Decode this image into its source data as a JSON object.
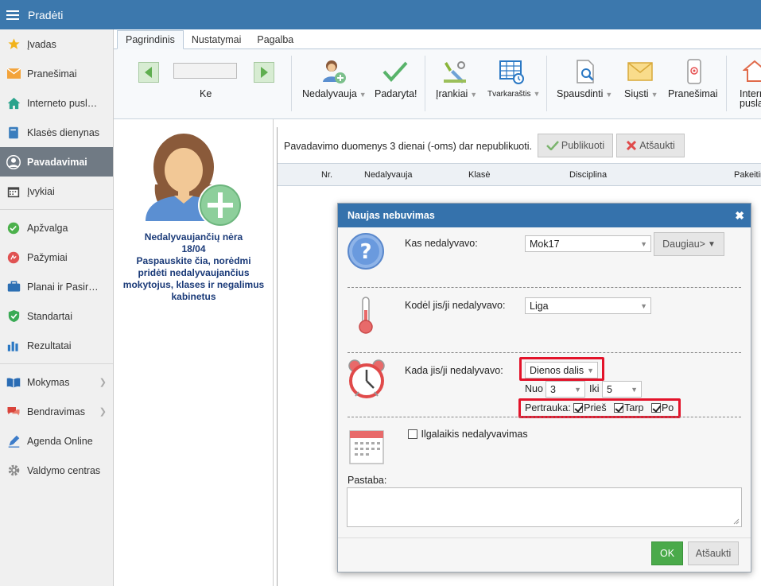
{
  "topbar": {
    "title": "Pradėti"
  },
  "sidebar": {
    "items": [
      {
        "label": "Įvadas",
        "icon": "star-icon"
      },
      {
        "label": "Pranešimai",
        "icon": "envelope-icon"
      },
      {
        "label": "Interneto pusl…",
        "icon": "home-icon"
      },
      {
        "label": "Klasės dienynas",
        "icon": "book-icon"
      },
      {
        "label": "Pavadavimai",
        "icon": "user-icon"
      },
      {
        "label": "Įvykiai",
        "icon": "calendar-icon"
      },
      {
        "label": "Apžvalga",
        "icon": "check-circle-icon"
      },
      {
        "label": "Pažymiai",
        "icon": "grade-icon"
      },
      {
        "label": "Planai ir Pasir…",
        "icon": "briefcase-icon"
      },
      {
        "label": "Standartai",
        "icon": "shield-icon"
      },
      {
        "label": "Rezultatai",
        "icon": "bar-chart-icon"
      },
      {
        "label": "Mokymas",
        "icon": "open-book-icon"
      },
      {
        "label": "Bendravimas",
        "icon": "chat-icon"
      },
      {
        "label": "Agenda Online",
        "icon": "pen-icon"
      },
      {
        "label": "Valdymo centras",
        "icon": "gear-icon"
      }
    ]
  },
  "ribbon": {
    "tabs": [
      "Pagrindinis",
      "Nustatymai",
      "Pagalba"
    ],
    "nav_label": "Ke",
    "buttons": {
      "nedalyvauja": "Nedalyvauja",
      "padaryta": "Padaryta!",
      "irankiai": "Įrankiai",
      "tvarkarastis": "Tvarkaraštis",
      "spausdinti": "Spausdinti",
      "siusti": "Siųsti",
      "pranesimai": "Pranešimai",
      "interneto": "Interne",
      "interneto2": "pusla"
    }
  },
  "leftpanel": {
    "line1": "Nedalyvaujančių nėra",
    "line2": "18/04",
    "line3": "Paspauskite čia, norėdmi",
    "line4": "pridėti nedalyvaujančius",
    "line5": "mokytojus, klases ir negalimus",
    "line6": "kabinetus"
  },
  "main": {
    "publish_msg": "Pavadavimo duomenys 3 dienai (-oms) dar nepublikuoti.",
    "publish_btn": "Publikuoti",
    "cancel_btn": "Atšaukti",
    "columns": [
      "Nr.",
      "Nedalyvauja",
      "Klasė",
      "Disciplina",
      "Pakeitin"
    ]
  },
  "modal": {
    "title": "Naujas nebuvimas",
    "who_label": "Kas nedalyvavo:",
    "who_value": "Mok17",
    "more_btn": "Daugiau>",
    "why_label": "Kodėl jis/ji nedalyvavo:",
    "why_value": "Liga",
    "when_label": "Kada jis/ji nedalyvavo:",
    "when_value": "Dienos dalis",
    "from_label": "Nuo",
    "from_value": "3",
    "to_label": "Iki",
    "to_value": "5",
    "break_label": "Pertrauka:",
    "break_before": "Prieš",
    "break_between": "Tarp",
    "break_after": "Po",
    "longterm_label": "Ilgalaikis nedalyvavimas",
    "note_label": "Pastaba:",
    "ok_btn": "OK",
    "cancel_btn": "Atšaukti"
  }
}
